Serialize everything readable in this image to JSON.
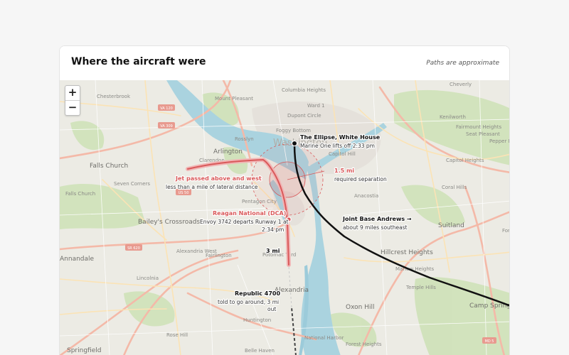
{
  "card": {
    "title": "Where the aircraft were",
    "note": "Paths are approximate"
  },
  "zoom": {
    "in_label": "+",
    "out_label": "−"
  },
  "colors": {
    "accent_red": "#d9595a",
    "path_black": "#111111",
    "water": "#aad3df",
    "park": "#c8deb0"
  },
  "map": {
    "places": [
      "Cheverly",
      "Columbia Heights",
      "Mount Pleasant",
      "Chesterbrook",
      "Ward 1",
      "Dupont Circle",
      "Kenilworth",
      "Fairmount Heights",
      "VA 120",
      "VA 309",
      "Foggy Bottom",
      "Seat Pleasant",
      "Rosslyn",
      "Arlington",
      "Clarendon",
      "Capitol Hill",
      "Pepper Mill Village",
      "Falls Church",
      "Capitol Heights",
      "Seven Corners",
      "Anacostia",
      "Coral Hills",
      "Falls Church",
      "US 50",
      "Pentagon City",
      "Suitland",
      "Bailey's Crossroads",
      "Forestville",
      "SR 620",
      "Alexandria West",
      "Hillcrest Heights",
      "Potomac Yard",
      "Fairlington",
      "Marlow Heights",
      "Annandale",
      "Lincolnia",
      "Temple Hills",
      "Alexandria",
      "Oxon Hill",
      "Camp Springs",
      "Huntington",
      "Rose Hill",
      "National Harbor",
      "MD 5",
      "Springfield",
      "Belle Haven",
      "Forest Heights",
      "Washington"
    ],
    "airports": [
      {
        "name": "Reagan National (DCA)",
        "lines": [
          "Envoy 3742 departs Runway 1 at",
          "2:34 pm"
        ]
      }
    ],
    "annotations": {
      "ellipse": {
        "title": "The Ellipse, White House",
        "sub": "Marine One lifts off 2:33 pm"
      },
      "jet": {
        "title": "Jet passed above and west",
        "sub": "less than a mile of lateral distance"
      },
      "separation": {
        "title": "1.5 mi",
        "sub": "required separation"
      },
      "andrews": {
        "title": "Joint Base Andrews →",
        "sub": "about 9 miles southeast"
      },
      "distance": {
        "title": "3 mi"
      },
      "republic": {
        "title": "Republic 4700",
        "sub_lines": [
          "told to go around, 3 mi",
          "out"
        ]
      }
    }
  }
}
